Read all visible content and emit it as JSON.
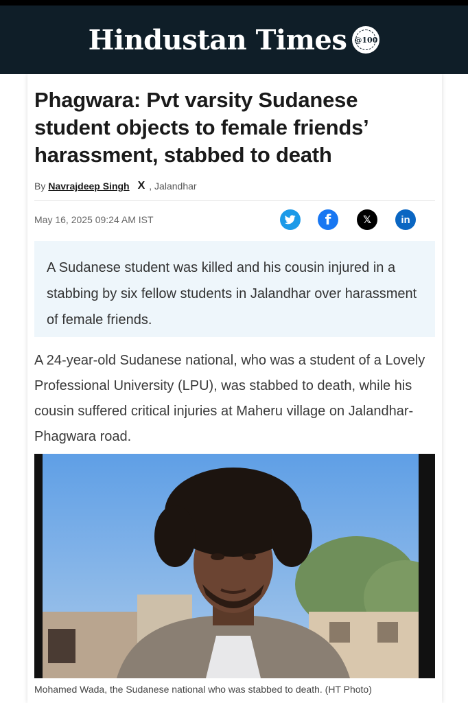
{
  "masthead": {
    "logo_text": "Hindustan Times",
    "seal_text": "@100"
  },
  "article": {
    "headline": "Phagwara: Pvt varsity Sudanese student objects to female friends’ harassment, stabbed to death",
    "byline_prefix": "By",
    "author": "Navrajdeep Singh",
    "location": ", Jalandhar",
    "date": "May 16, 2025 09:24 AM IST",
    "summary": "A Sudanese student was killed and his cousin injured in a stabbing by six fellow students in Jalandhar over harassment of female friends.",
    "body": "A 24-year-old Sudanese national, who was a student of a Lovely Professional University (LPU), was stabbed to death, while his cousin suffered critical injuries at Maheru village on Jalandhar-Phagwara road.",
    "photo_caption": "Mohamed Wada, the Sudanese national who was stabbed to death. (HT Photo)"
  },
  "share": {
    "twitter_icon": "twitter-bird-icon",
    "facebook_icon": "facebook-icon",
    "x_icon": "x-icon",
    "linkedin_icon": "linkedin-icon",
    "facebook_glyph": "f",
    "x_glyph": "𝕏",
    "linkedin_glyph": "in"
  },
  "colors": {
    "masthead_bg": "#0f1e28",
    "summary_bg": "#eef6fb",
    "twitter": "#1c9ae8",
    "facebook": "#1877f2",
    "linkedin": "#0a66c2"
  }
}
